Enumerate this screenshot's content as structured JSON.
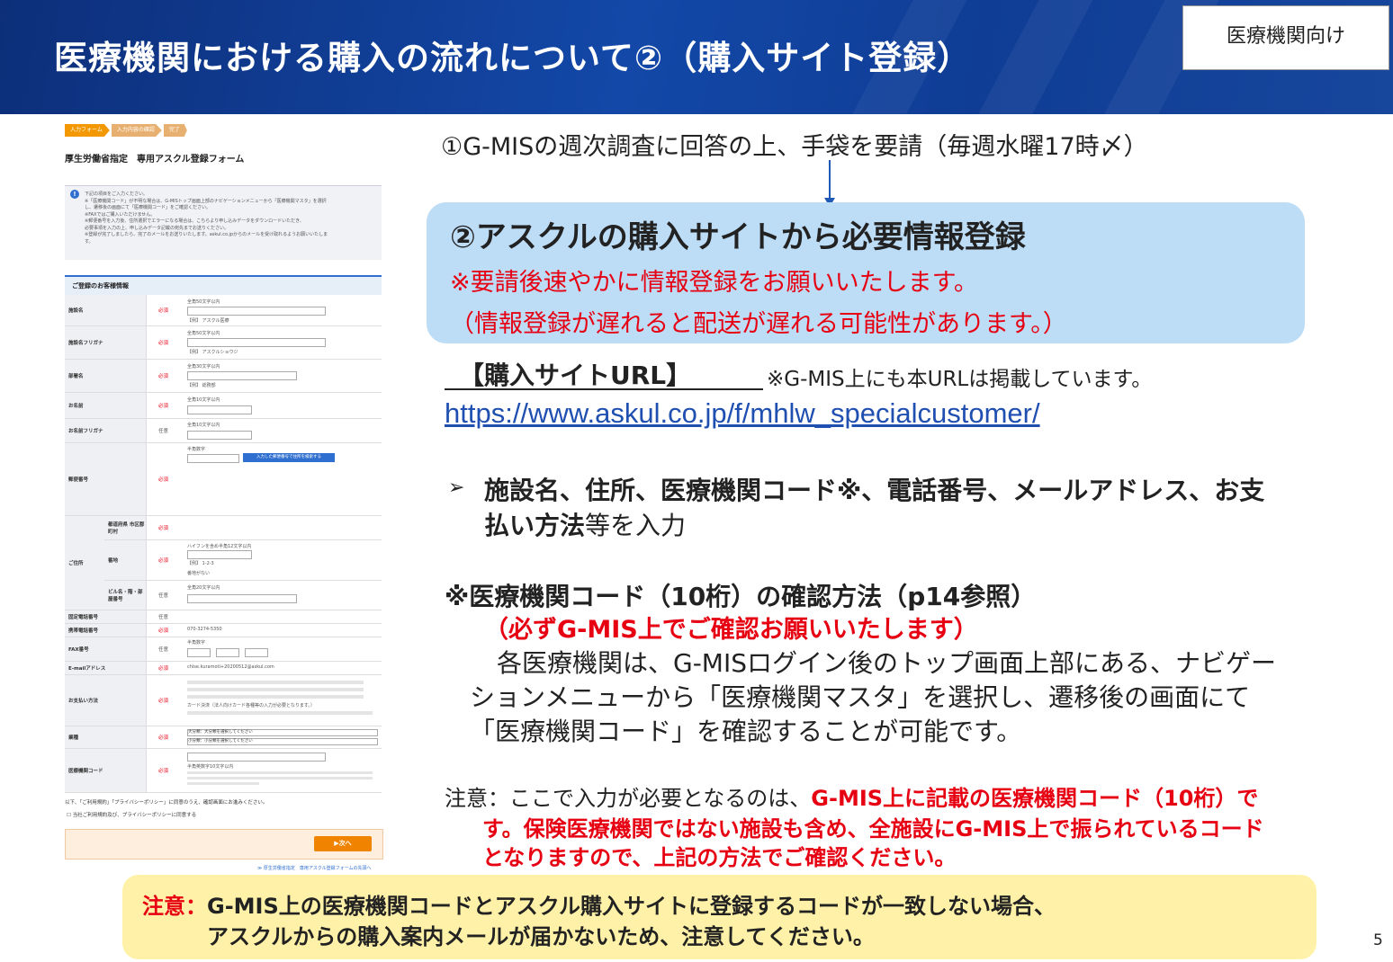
{
  "header": {
    "title": "医療機関における購入の流れについて②（購入サイト登録）",
    "badge": "医療機関向け"
  },
  "form": {
    "steps": [
      "入力フォーム",
      "入力内容の確認",
      "完了"
    ],
    "title": "厚生労働省指定　専用アスクル登録フォーム",
    "notice_lines": [
      "下記の項目をご入力ください。",
      "※「医療機関コード」が不明な場合は、G-MISトップ画面上部のナビゲーションメニューから「医療機関マスタ」を選択",
      "し、遷移後の画面にて「医療機関コード」をご確認ください。",
      "※FAXではご購入いただけません。",
      "※郵便番号を入力後、住所選択でエラーになる場合は、こちらより申し込みデータをダウンロードいただき、",
      "必要事項を入力の上、申し込みデータ記載の宛先までお送りください。",
      "※登録が完了しましたら、完了のメールをお送りいたします。askul.co.jpからのメールを受け取れるようお願いいたしま",
      "す。"
    ],
    "section_title": "ご登録のお客様情報",
    "rows": [
      {
        "label": "施設名",
        "req": "必須",
        "hint": "全角50文字以内",
        "sample": "【例】 アスクル医療"
      },
      {
        "label": "施設名フリガナ",
        "req": "必須",
        "hint": "全角50文字以内",
        "sample": "【例】 アスクルショウジ"
      },
      {
        "label": "部署名",
        "req": "必須",
        "hint": "全角30文字以内",
        "sample": "【例】 総務部"
      },
      {
        "label": "お名前",
        "req": "必須",
        "hint": "全角10文字以内",
        "sample": ""
      },
      {
        "label": "お名前フリガナ",
        "req": "任意",
        "hint": "全角10文字以内",
        "sample": ""
      },
      {
        "label": "郵便番号",
        "req": "必須",
        "hint": "半角数字",
        "sample": "入力した郵便番号で住所を検索する"
      },
      {
        "label": "都道府県 市区郡 町村",
        "req": "必須",
        "hint": "",
        "sample": ""
      },
      {
        "label": "番地",
        "req": "必須",
        "hint": "ハイフンを含め半角12文字以内",
        "sample": "【例】 1-2-3"
      },
      {
        "label": "ビル名・階・部屋番号",
        "req": "任意",
        "hint": "全角20文字以内",
        "sample": ""
      },
      {
        "label": "固定電話番号",
        "req": "任意",
        "hint": "",
        "sample": ""
      },
      {
        "label": "携帯電話番号",
        "req": "必須",
        "hint": "070-3274-5350",
        "sample": ""
      },
      {
        "label": "FAX番号",
        "req": "任意",
        "hint": "半角数字",
        "sample": ""
      },
      {
        "label": "E-mailアドレス",
        "req": "必須",
        "hint": "chise.kuramoti+20200512@askul.com",
        "sample": ""
      },
      {
        "label": "お支払い方法",
        "req": "必須",
        "hint": "カード決済（法人向けカード各種等の入力が必要となります。）",
        "sample": ""
      },
      {
        "label": "業種",
        "req": "必須",
        "hint": "大分類：大分類を選択してください",
        "sample": "小分類：小分類を選択してください"
      },
      {
        "label": "医療機関コード",
        "req": "必須",
        "hint": "半角英数字10文字以内",
        "sample": ""
      }
    ],
    "address_label": "ご住所",
    "no_address": "番地がない",
    "agree_line1": "以下、「ご利用規約」「プライバシーポリシー」に同意のうえ、確認画面にお進みください。",
    "agree_line2": "当社ご利用規約及び、プライバシーポリシーに同意する",
    "next_button": "次へ",
    "footer_link": "≫ 厚生労働省指定　専用アスクル登録フォームの先頭へ"
  },
  "content": {
    "step1": "①G-MISの週次調査に回答の上、手袋を要請（毎週水曜17時〆）",
    "step2_heading": "②アスクルの購入サイトから必要情報登録",
    "step2_red1": "※要請後速やかに情報登録をお願いいたします。",
    "step2_red2": "（情報登録が遅れると配送が遅れる可能性があります。）",
    "url_heading": "【購入サイトURL】",
    "url_note": "※G-MIS上にも本URLは掲載しています。",
    "url": "https://www.askul.co.jp/f/mhlw_specialcustomer/",
    "bullet_mark": "➢",
    "bullet_line1": "施設名、住所、医療機関コード※、電話番号、メールアドレス、お支",
    "bullet_line2_bold": "払い方法",
    "bullet_line2_rest": "等を入力",
    "code_heading": "※医療機関コード（10桁）の確認方法（p14参照）",
    "code_red": "（必ずG-MIS上でご確認お願いいたします）",
    "code_p1": "各医療機関は、G-MISログイン後のトップ画面上部にある、ナビゲー",
    "code_p2": "ションメニューから「医療機関マスタ」を選択し、遷移後の画面にて",
    "code_p3": "「医療機関コード」を確認することが可能です。",
    "note_prefix": "注意：ここで入力が必要となるのは、",
    "note_red1": "G-MIS上に記載の医療機関コード（10桁）で",
    "note_red2": "す。保険医療機関ではない施設も含め、全施設にG-MIS上で振られているコード",
    "note_red3": "となりますので、上記の方法でご確認ください。"
  },
  "yellow_note": {
    "prefix": "注意：",
    "line1": "G-MIS上の医療機関コードとアスクル購入サイトに登録するコードが一致しない場合、",
    "line2": "アスクルからの購入案内メールが届かないため、注意してください。"
  },
  "page_number": "5",
  "colors": {
    "header_blue": "#1348a8",
    "accent_red": "#e60012",
    "link_blue": "#1f4fb0",
    "light_blue_box": "#bddcf6",
    "yellow_box": "#fff2a8"
  }
}
